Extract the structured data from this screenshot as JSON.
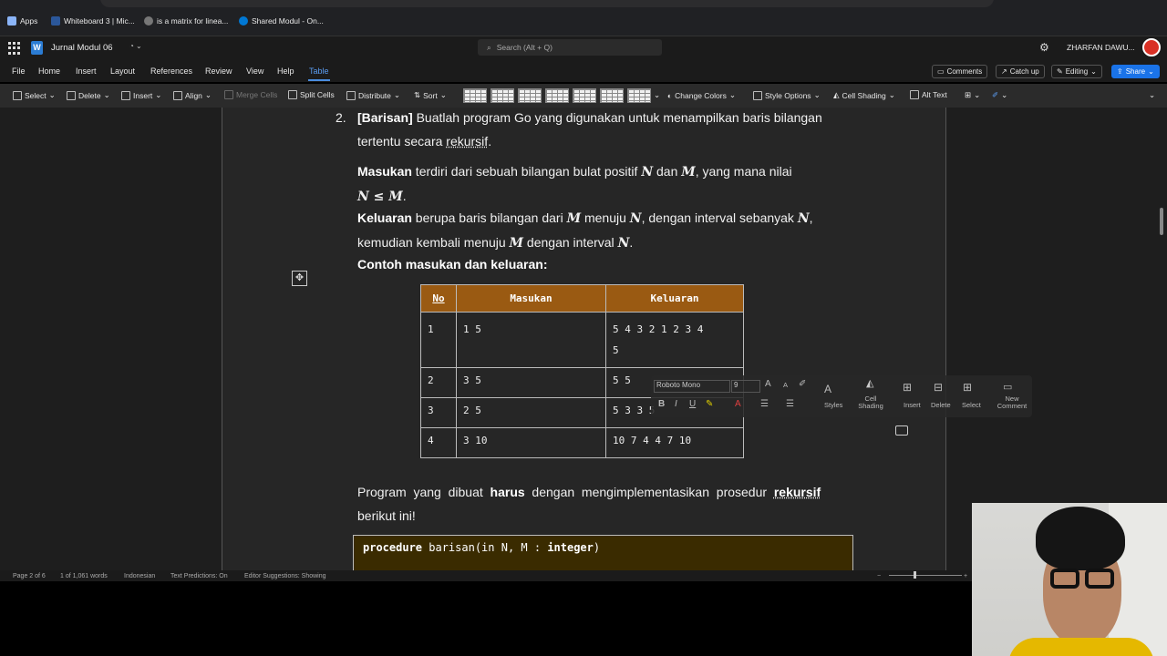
{
  "bookmarks": [
    {
      "label": "Apps",
      "color": "#5f6368"
    },
    {
      "label": "Whiteboard 3 | Mic...",
      "color": "#2b579a"
    },
    {
      "label": "is a matrix for linea...",
      "color": "#555555"
    },
    {
      "label": "Shared Modul - On...",
      "color": "#0078d4"
    }
  ],
  "header": {
    "doc_title": "Jurnal Modul 06",
    "search_placeholder": "Search (Alt + Q)",
    "user_name": "ZHARFAN DAWU..."
  },
  "menu": {
    "tabs": [
      "File",
      "Home",
      "Insert",
      "Layout",
      "References",
      "Review",
      "View",
      "Help",
      "Table"
    ],
    "active_tab": "Table",
    "comments": "Comments",
    "catch_up": "Catch up",
    "editing": "Editing",
    "share": "Share"
  },
  "ribbon": {
    "select": "Select",
    "delete": "Delete",
    "insert": "Insert",
    "align": "Align",
    "merge_cells": "Merge Cells",
    "split_cells": "Split Cells",
    "distribute": "Distribute",
    "sort": "Sort",
    "change_colors": "Change Colors",
    "style_options": "Style Options",
    "cell_shading": "Cell Shading",
    "alt_text": "Alt Text"
  },
  "document": {
    "item_number": "2.",
    "heading_tag": "[Barisan]",
    "heading_text": " Buatlah program Go yang digunakan untuk menampilkan baris bilangan",
    "heading_line2_a": "tertentu secara ",
    "heading_line2_b": "rekursif",
    "heading_line2_c": ".",
    "input_label": "Masukan",
    "input_text_a": " terdiri dari sebuah bilangan bulat positif ",
    "input_text_b": " dan ",
    "input_text_c": ",   yang mana nilai",
    "input_line2": "N ≤ M",
    "output_label": "Keluaran",
    "output_text_a": " berupa baris bilangan dari ",
    "output_text_b": " menuju ",
    "output_text_c": ", dengan interval sebanyak ",
    "output_line2_a": "kemudian kembali menuju ",
    "output_line2_b": "  dengan interval ",
    "var_n": "N",
    "var_m": "M",
    "example_heading": "Contoh masukan dan keluaran:",
    "program_text_a": "Program  yang  dibuat  ",
    "program_bold_a": "harus",
    "program_text_b": "  dengan  mengimplementasikan  prosedur  ",
    "program_bold_b": "rekursif",
    "program_line2": "berikut ini!"
  },
  "example_table": {
    "headers": [
      "No",
      "Masukan",
      "Keluaran"
    ],
    "rows": [
      [
        "1",
        "1 5",
        "5 4 3 2 1 2 3  4",
        "5"
      ],
      [
        "2",
        "3 5",
        "5 5",
        ""
      ],
      [
        "3",
        "2 5",
        "5 3 3 5",
        ""
      ],
      [
        "4",
        "3 10",
        "10 7 4 4 7 10",
        ""
      ]
    ]
  },
  "mini_toolbar": {
    "font": "Roboto Mono",
    "size": "9",
    "styles": "Styles",
    "cell_shading": "Cell Shading",
    "insert": "Insert",
    "delete": "Delete",
    "select": "Select",
    "new_comment": "New Comment"
  },
  "code": {
    "keyword": "procedure",
    "signature": " barisan(in N, M : ",
    "type": "integer",
    "close": ")"
  },
  "status": {
    "page": "Page 2 of 6",
    "words": "1 of 1,061 words",
    "language": "Indonesian",
    "predictions": "Text Predictions: On",
    "editor": "Editor Suggestions: Showing"
  }
}
